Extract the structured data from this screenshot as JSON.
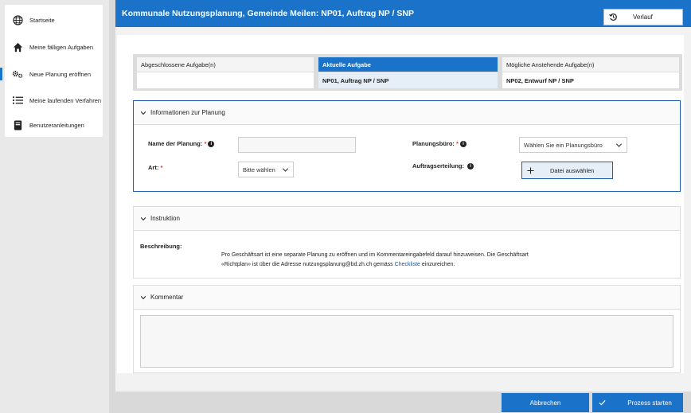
{
  "sidebar": {
    "items": [
      {
        "label": "Startseite",
        "icon": "globe-icon"
      },
      {
        "label": "Meine fälligen Aufgaben",
        "icon": "home-icon"
      },
      {
        "label": "Neue Planung eröffnen",
        "icon": "gears-icon"
      },
      {
        "label": "Meine laufenden Verfahren",
        "icon": "list-icon"
      },
      {
        "label": "Benutzeranleitungen",
        "icon": "book-icon"
      }
    ]
  },
  "header": {
    "title": "Kommunale Nutzungsplanung, Gemeinde Meilen: NP01, Auftrag NP / SNP",
    "verlauf_label": "Verlauf"
  },
  "steps": {
    "done": {
      "title": "Abgeschlossene Aufgabe(n)",
      "value": ""
    },
    "current": {
      "title": "Aktuelle Aufgabe",
      "value": "NP01, Auftrag NP / SNP"
    },
    "next": {
      "title": "Mögliche Anstehende Aufgabe(n)",
      "value": "NP02, Entwurf NP / SNP"
    }
  },
  "info_panel": {
    "title": "Informationen zur Planung",
    "name_label": "Name der Planung:",
    "name_value": "",
    "art_label": "Art:",
    "art_value": "Bitte wählen",
    "buero_label": "Planungsbüro:",
    "buero_value": "Wählen Sie ein Planungsbüro",
    "auftrag_label": "Auftragserteilung:",
    "file_label": "Datei auswählen",
    "required_mark": "*",
    "info_glyph": "i"
  },
  "instruktion": {
    "title": "Instruktion",
    "desc_label": "Beschreibung:",
    "text1": "Pro Geschäftsart ist eine separate Planung zu eröffnen und im Kommentareingabefeld darauf hinzuweisen. Die Geschäftsart",
    "text2": "«Richtplan» ist über die Adresse nutzungsplanung@bd.zh.ch gemäss ",
    "link": "Checkliste",
    "text3": " einzureichen."
  },
  "kommentar": {
    "title": "Kommentar",
    "value": ""
  },
  "footer": {
    "cancel_label": "Abbrechen",
    "start_label": "Prozess starten"
  },
  "colors": {
    "accent": "#1a73c9",
    "required": "#d33333"
  }
}
